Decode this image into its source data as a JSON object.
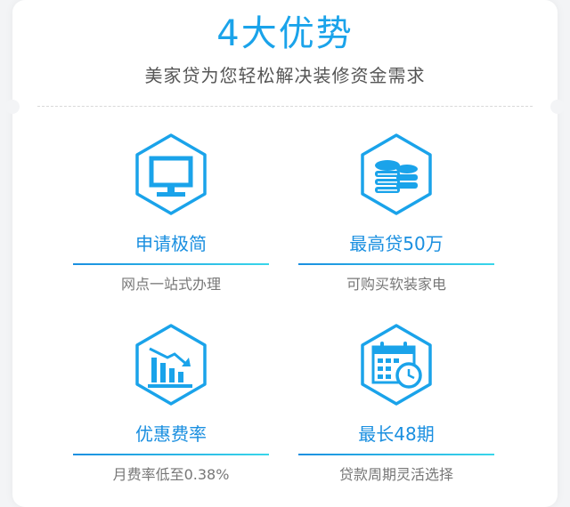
{
  "header": {
    "title": "4大优势",
    "subtitle": "美家贷为您轻松解决装修资金需求"
  },
  "features": [
    {
      "icon": "monitor-icon",
      "title": "申请极简",
      "desc": "网点一站式办理"
    },
    {
      "icon": "coins-icon",
      "title": "最高贷50万",
      "desc": "可购买软装家电"
    },
    {
      "icon": "declining-chart-icon",
      "title": "优惠费率",
      "desc": "月费率低至0.38%"
    },
    {
      "icon": "calendar-clock-icon",
      "title": "最长48期",
      "desc": "贷款周期灵活选择"
    }
  ],
  "colors": {
    "accent": "#1aa3ea",
    "accent_light": "#38d6ea"
  }
}
